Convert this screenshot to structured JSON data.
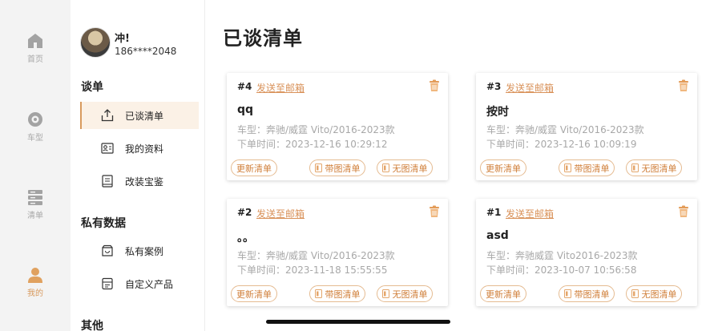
{
  "nav_rail": [
    {
      "key": "home",
      "label": "首页",
      "icon": "home-icon",
      "active": false
    },
    {
      "key": "models",
      "label": "车型",
      "icon": "car-model-icon",
      "active": false
    },
    {
      "key": "list",
      "label": "清单",
      "icon": "list-icon",
      "active": false
    },
    {
      "key": "me",
      "label": "我的",
      "icon": "person-icon",
      "active": true
    }
  ],
  "user": {
    "name": "冲!",
    "phone": "186****2048"
  },
  "menu": {
    "section1": "谈单",
    "items1": [
      {
        "label": "已谈清单",
        "icon": "upload-icon"
      },
      {
        "label": "我的资料",
        "icon": "id-card-icon"
      },
      {
        "label": "改装宝鉴",
        "icon": "book-icon"
      }
    ],
    "section2": "私有数据",
    "items2": [
      {
        "label": "私有案例",
        "icon": "box-icon"
      },
      {
        "label": "自定义产品",
        "icon": "product-icon"
      }
    ],
    "section3": "其他"
  },
  "page": {
    "title": "已谈清单"
  },
  "colors": {
    "accent": "#d89a5e",
    "rail_bg": "#f3f3f3"
  },
  "cards": [
    {
      "num": "#4",
      "mail": "发送至邮箱",
      "name": "qq",
      "model": "车型：奔驰/威霆 Vito/2016-2023款",
      "time": "下单时间：2023-12-16 10:29:12",
      "btn_update": "更新清单",
      "btn_pic": "带图清单",
      "btn_nopic": "无图清单"
    },
    {
      "num": "#3",
      "mail": "发送至邮箱",
      "name": "按时",
      "model": "车型：奔驰/威霆 Vito/2016-2023款",
      "time": "下单时间：2023-12-16 10:09:19",
      "btn_update": "更新清单",
      "btn_pic": "带图清单",
      "btn_nopic": "无图清单"
    },
    {
      "num": "#2",
      "mail": "发送至邮箱",
      "name": "。。",
      "model": "车型：奔驰/威霆 Vito/2016-2023款",
      "time": "下单时间：2023-11-18 15:55:55",
      "btn_update": "更新清单",
      "btn_pic": "带图清单",
      "btn_nopic": "无图清单"
    },
    {
      "num": "#1",
      "mail": "发送至邮箱",
      "name": "asd",
      "model": "车型：奔驰威霆 Vito2016-2023款",
      "time": "下单时间：2023-10-07 10:56:58",
      "btn_update": "更新清单",
      "btn_pic": "带图清单",
      "btn_nopic": "无图清单"
    }
  ]
}
